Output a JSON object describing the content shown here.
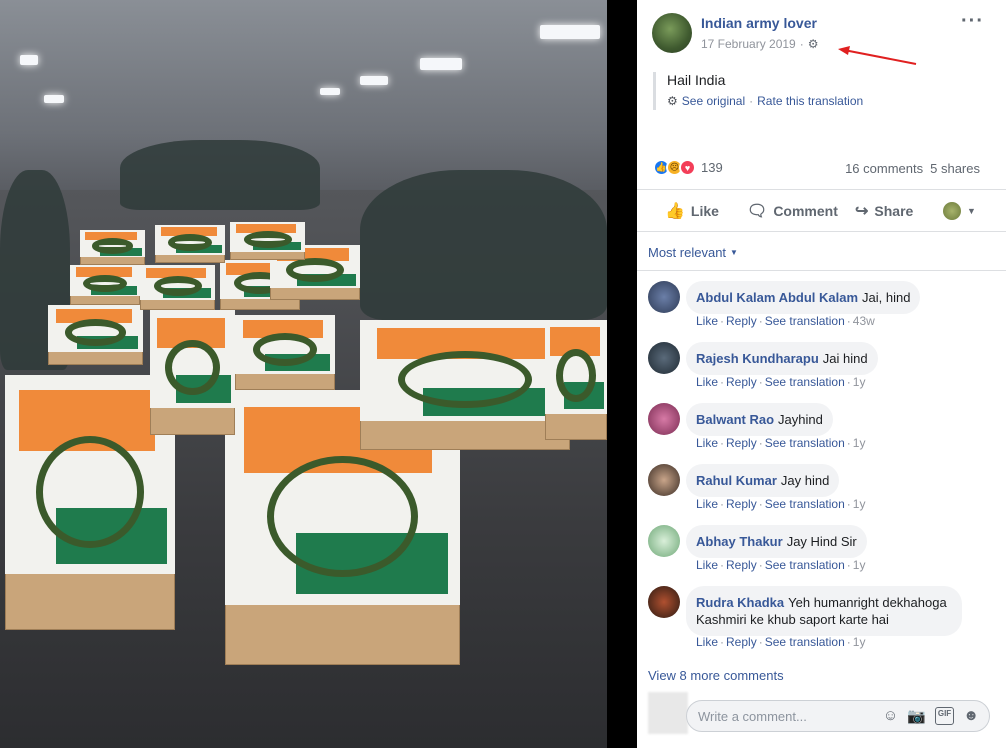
{
  "post": {
    "author": "Indian army lover",
    "date": "17 February 2019",
    "text": "Hail India",
    "see_original": "See original",
    "rate_translation": "Rate this translation",
    "reaction_count": "139",
    "comments_count": "16 comments",
    "shares_count": "5 shares"
  },
  "actions": {
    "like": "Like",
    "comment": "Comment",
    "share": "Share"
  },
  "comments_section": {
    "sort_label": "Most relevant",
    "view_more": "View 8 more comments",
    "write_placeholder": "Write a comment...",
    "reply_label": "Reply",
    "like_label": "Like",
    "see_translation": "See translation"
  },
  "comments": [
    {
      "name": "Abdul Kalam Abdul Kalam",
      "text": "Jai, hind",
      "ago": "43w"
    },
    {
      "name": "Rajesh Kundharapu",
      "text": "Jai hind",
      "ago": "1y"
    },
    {
      "name": "Balwant Rao",
      "text": "Jayhind",
      "ago": "1y"
    },
    {
      "name": "Rahul Kumar",
      "text": "Jay hind",
      "ago": "1y"
    },
    {
      "name": "Abhay Thakur",
      "text": "Jay Hind Sir",
      "ago": "1y"
    },
    {
      "name": "Rudra Khadka",
      "text": "Yeh humanright dekhahoga Kashmiri ke khub saport karte hai",
      "ago": "1y"
    }
  ],
  "colors": {
    "link": "#385898",
    "annotation_arrow": "#e02020",
    "flag_saffron": "#f08a3a",
    "flag_green": "#1f7b4d"
  }
}
